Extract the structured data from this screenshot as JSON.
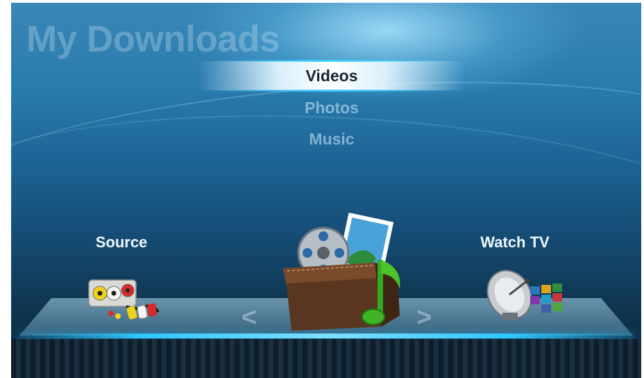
{
  "page": {
    "title": "My Downloads"
  },
  "menu": {
    "items": [
      {
        "label": "Videos",
        "selected": true
      },
      {
        "label": "Photos",
        "selected": false
      },
      {
        "label": "Music",
        "selected": false
      }
    ]
  },
  "nav": {
    "left_label": "Source",
    "right_label": "Watch TV",
    "prev_arrow": "<",
    "next_arrow": ">",
    "left_icon": "av-connector-icon",
    "center_icon": "media-box-icon",
    "right_icon": "satellite-dish-icon"
  },
  "colors": {
    "background_top": "#3a86b6",
    "background_bottom": "#0b2538",
    "accent_glow": "#2fc6ff",
    "selected_text": "#1a2633",
    "label_text": "#eef6fb"
  }
}
